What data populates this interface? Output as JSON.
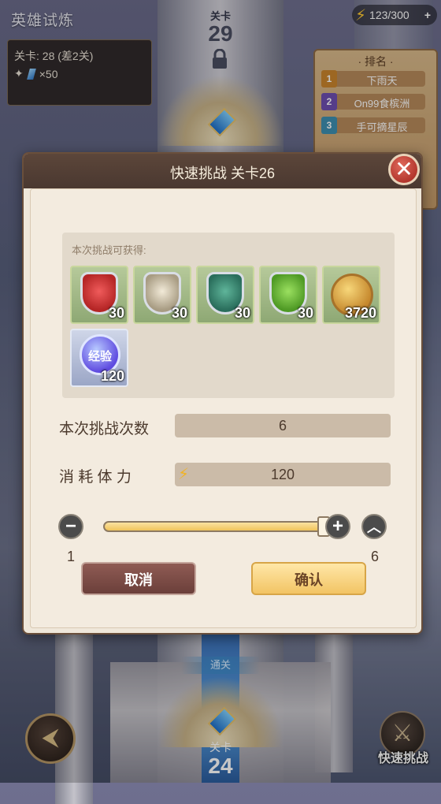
{
  "page": {
    "title": "英雄试炼"
  },
  "top_stage": {
    "label": "关卡",
    "number": "29"
  },
  "info_box": {
    "stage_line": "关卡: 28 (差2关)",
    "reward_line": "×50"
  },
  "energy": {
    "value": "123/300",
    "plus": "+"
  },
  "ranking": {
    "title": "· 排名 ·",
    "entries": [
      {
        "rank": "1",
        "name": "下雨天",
        "color": "#c9842c"
      },
      {
        "rank": "2",
        "name": "On99食槟洲",
        "color": "#6d4fb0"
      },
      {
        "rank": "3",
        "name": "手可摘星辰",
        "color": "#3d8fb0"
      }
    ]
  },
  "dialog": {
    "title": "快速挑战 关卡26",
    "close": "✕",
    "rewards_label": "本次挑战可获得:",
    "rewards": [
      {
        "icon": "red-shield-icon",
        "count": "30",
        "color": "#d23b3b"
      },
      {
        "icon": "white-shield-icon",
        "count": "30",
        "color": "#c8bba0"
      },
      {
        "icon": "teal-shield-icon",
        "count": "30",
        "color": "#3e8a74"
      },
      {
        "icon": "green-shield-icon",
        "count": "30",
        "color": "#6ab33e"
      },
      {
        "icon": "gold-coin-icon",
        "count": "3720",
        "color": "#d7a348"
      },
      {
        "icon": "exp-orb-icon",
        "count": "120",
        "label": "经验",
        "color": "#6b5ae6"
      }
    ],
    "challenge_count_label": "本次挑战次数",
    "challenge_count_value": "6",
    "stamina_label": "消 耗 体 力",
    "stamina_value": "120",
    "slider": {
      "min": "1",
      "max": "6",
      "current": 6
    },
    "cancel": "取消",
    "confirm": "确认"
  },
  "bottom": {
    "passed_label": "通关",
    "stage_label": "关卡",
    "stage_number": "24",
    "quick_challenge": "快速挑战"
  }
}
